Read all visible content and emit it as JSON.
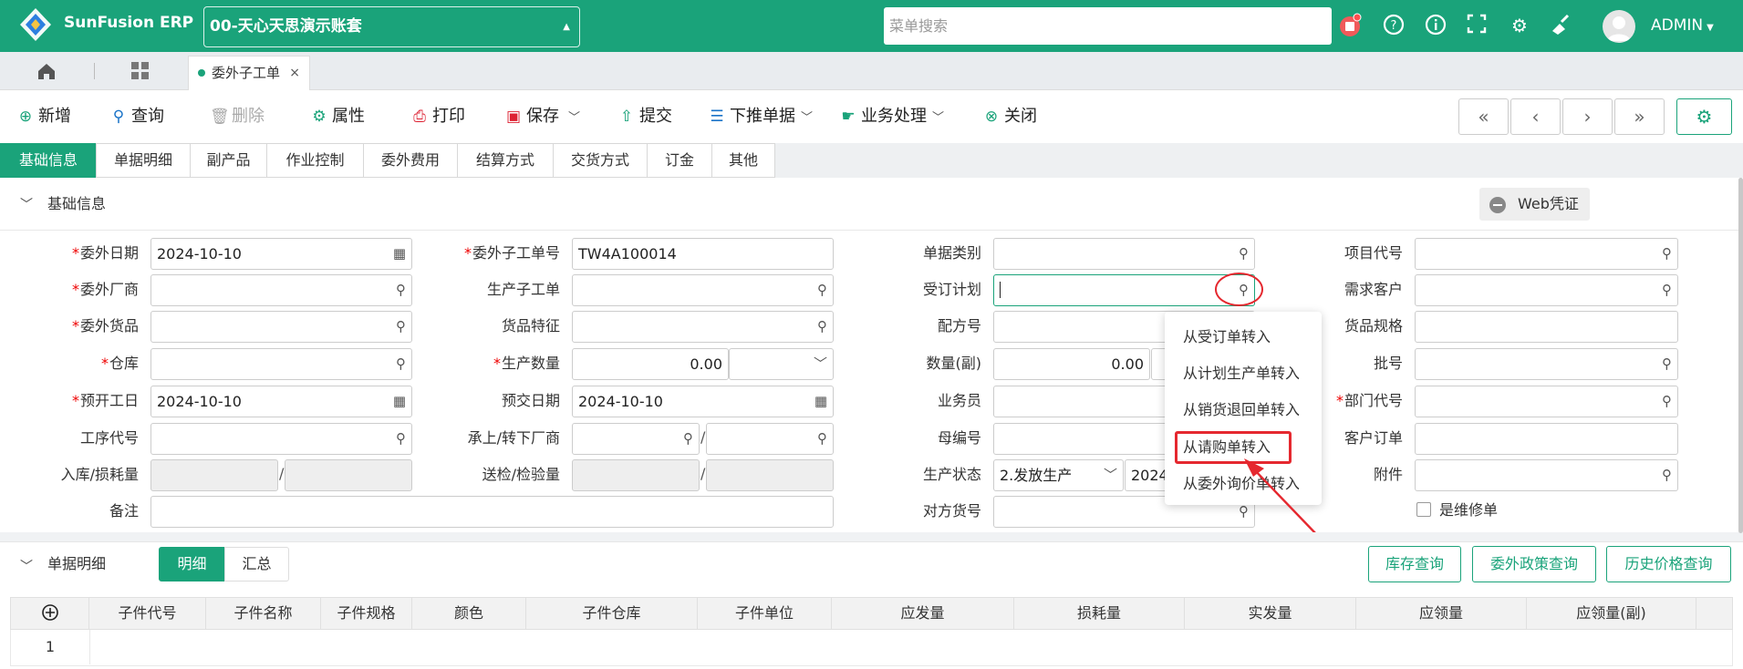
{
  "app": {
    "name": "SunFusion ERP",
    "account": "00-天心天思演示账套"
  },
  "topbar": {
    "search_placeholder": "菜单搜索",
    "user": "ADMIN"
  },
  "tabs": {
    "doc_tab": "委外子工单",
    "doc_tab_close": "×"
  },
  "toolbar": {
    "add": "新增",
    "query": "查询",
    "delete": "删除",
    "property": "属性",
    "print": "打印",
    "save": "保存",
    "submit": "提交",
    "push": "下推单据",
    "business": "业务处理",
    "close": "关闭"
  },
  "nav": {
    "first": "«",
    "prev": "‹",
    "next": "›",
    "last": "»"
  },
  "subtabs": [
    "基础信息",
    "单据明细",
    "副产品",
    "作业控制",
    "委外费用",
    "结算方式",
    "交货方式",
    "订金",
    "其他"
  ],
  "basic": {
    "section": "基础信息",
    "web_voucher": "Web凭证",
    "labels": {
      "outsource_date": "委外日期",
      "vendor": "委外厂商",
      "goods": "委外货品",
      "warehouse": "仓库",
      "start_date": "预开工日",
      "process_code": "工序代号",
      "inbound_loss": "入库/损耗量",
      "remark": "备注",
      "sub_order_no": "委外子工单号",
      "prod_sub_order": "生产子工单",
      "goods_feature": "货品特征",
      "prod_qty": "生产数量",
      "due_date": "预交日期",
      "vendor_transfer": "承上/转下厂商",
      "inspect": "送检/检验量",
      "doc_type": "单据类别",
      "order_plan": "受订计划",
      "formula": "配方号",
      "qty_sub": "数量(副)",
      "salesman": "业务员",
      "parent_no": "母编号",
      "prod_status": "生产状态",
      "counter_goods": "对方货号",
      "project": "项目代号",
      "demand_customer": "需求客户",
      "goods_spec": "货品规格",
      "batch": "批号",
      "dept": "部门代号",
      "customer_order": "客户订单",
      "attachment": "附件",
      "repair": "是维修单"
    },
    "values": {
      "outsource_date": "2024-10-10",
      "sub_order_no": "TW4A100014",
      "start_date": "2024-10-10",
      "due_date": "2024-10-10",
      "prod_qty": "0.00",
      "qty_sub": "0.00",
      "prod_status": "2.发放生产",
      "status_date": "2024"
    },
    "required_mark": "*"
  },
  "dropdown": [
    "从受订单转入",
    "从计划生产单转入",
    "从销货退回单转入",
    "从请购单转入",
    "从委外询价单转入"
  ],
  "detail": {
    "section": "单据明细",
    "seg": [
      "明细",
      "汇总"
    ],
    "buttons": [
      "库存查询",
      "委外政策查询",
      "历史价格查询"
    ],
    "columns": [
      "子件代号",
      "子件名称",
      "子件规格",
      "颜色",
      "子件仓库",
      "子件单位",
      "应发量",
      "损耗量",
      "实发量",
      "应领量",
      "应领量(副)"
    ],
    "rows": [
      "1"
    ]
  }
}
